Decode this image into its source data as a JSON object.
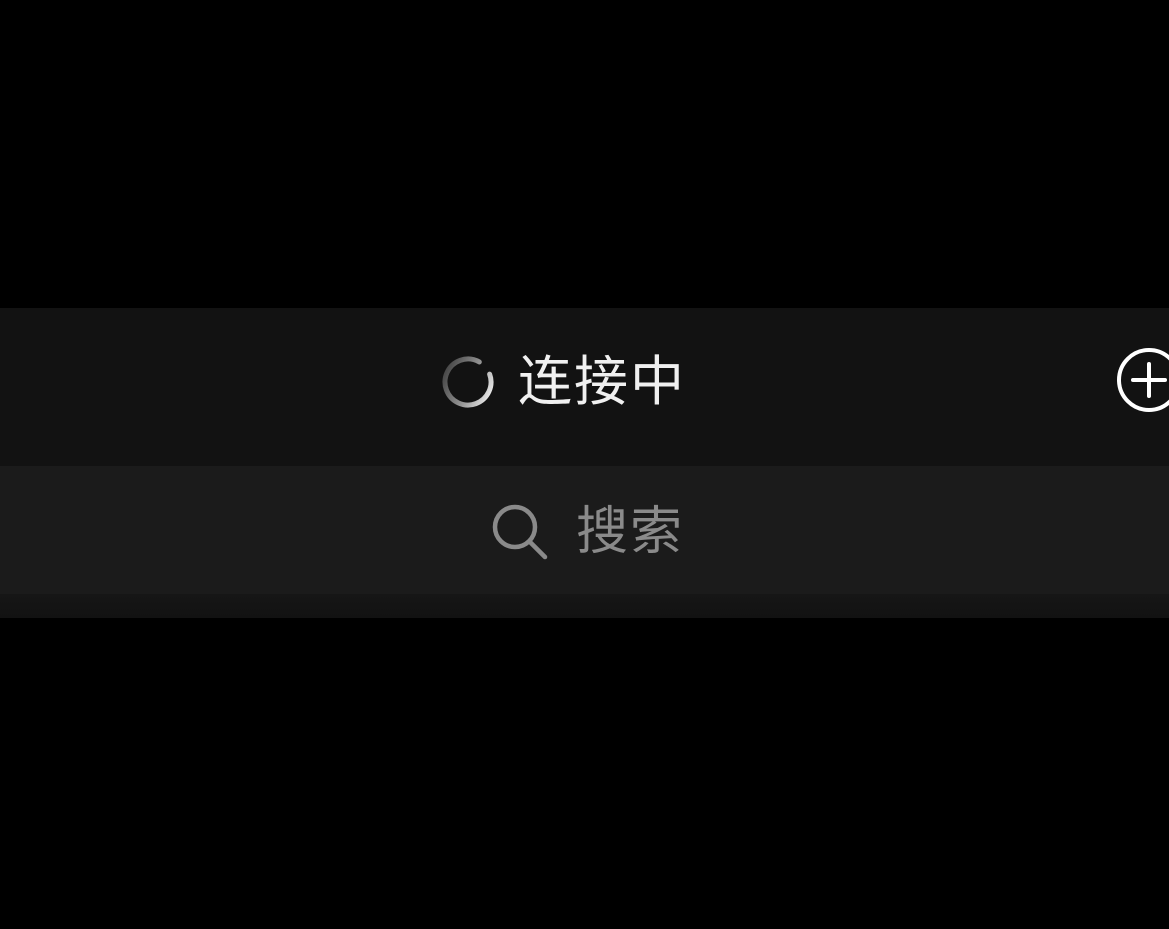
{
  "header": {
    "title": "连接中",
    "status_icon": "loading-spinner-icon",
    "add_icon": "plus-circle-icon"
  },
  "search": {
    "placeholder": "搜索",
    "icon": "search-icon"
  },
  "colors": {
    "background": "#000000",
    "header_bg": "#121212",
    "search_bg": "#1b1b1b",
    "title_text": "#f0f0f0",
    "placeholder_text": "#8a8a8a",
    "icon_stroke": "#ffffff"
  }
}
